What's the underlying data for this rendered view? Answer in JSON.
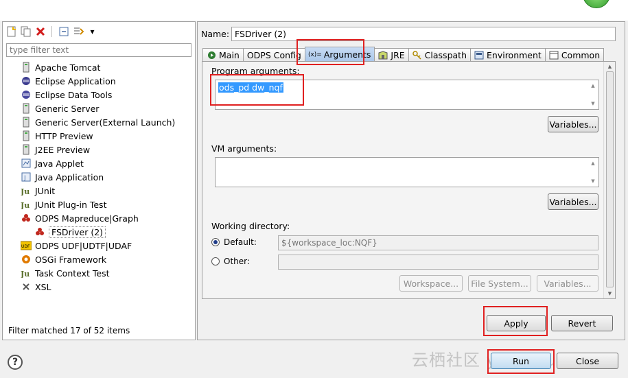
{
  "left_panel": {
    "filter_placeholder": "type filter text",
    "tree": [
      {
        "label": "Apache Tomcat",
        "icon": "tomcat-icon"
      },
      {
        "label": "Eclipse Application",
        "icon": "eclipse-icon"
      },
      {
        "label": "Eclipse Data Tools",
        "icon": "data-tools-icon"
      },
      {
        "label": "Generic Server",
        "icon": "server-icon"
      },
      {
        "label": "Generic Server(External Launch)",
        "icon": "server-icon"
      },
      {
        "label": "HTTP Preview",
        "icon": "server-icon"
      },
      {
        "label": "J2EE Preview",
        "icon": "server-icon"
      },
      {
        "label": "Java Applet",
        "icon": "applet-icon"
      },
      {
        "label": "Java Application",
        "icon": "java-app-icon"
      },
      {
        "label": "JUnit",
        "icon": "junit-icon"
      },
      {
        "label": "JUnit Plug-in Test",
        "icon": "junit-plugin-icon"
      },
      {
        "label": "ODPS Mapreduce|Graph",
        "icon": "odps-icon"
      },
      {
        "label": "FSDriver (2)",
        "icon": "odps-icon",
        "child": true,
        "selected": true
      },
      {
        "label": "ODPS UDF|UDTF|UDAF",
        "icon": "udf-icon"
      },
      {
        "label": "OSGi Framework",
        "icon": "osgi-icon"
      },
      {
        "label": "Task Context Test",
        "icon": "junit-icon"
      },
      {
        "label": "XSL",
        "icon": "xsl-icon"
      }
    ],
    "status": "Filter matched 17 of 52 items"
  },
  "right_panel": {
    "name_label": "Name:",
    "name_value": "FSDriver (2)",
    "tabs": [
      {
        "label": "Main",
        "icon": "main-icon"
      },
      {
        "label": "ODPS Config",
        "icon": ""
      },
      {
        "label": "Arguments",
        "icon": "arguments-icon",
        "active": true
      },
      {
        "label": "JRE",
        "icon": "jre-icon"
      },
      {
        "label": "Classpath",
        "icon": "classpath-icon"
      },
      {
        "label": "Environment",
        "icon": "environment-icon"
      },
      {
        "label": "Common",
        "icon": "common-icon"
      }
    ],
    "program_args_label": "Program arguments:",
    "program_args_value": "ods_pd dw_nqf",
    "vm_args_label": "VM arguments:",
    "vm_args_value": "",
    "variables_label": "Variables...",
    "working_dir_label": "Working directory:",
    "default_label": "Default:",
    "default_value": "${workspace_loc:NQF}",
    "other_label": "Other:",
    "workspace_btn": "Workspace...",
    "filesystem_btn": "File System...",
    "variables_btn": "Variables..."
  },
  "buttons": {
    "apply": "Apply",
    "revert": "Revert",
    "run": "Run",
    "close": "Close"
  },
  "help_icon": "?",
  "watermark": "云栖社区 yq.aliyun.com",
  "colors": {
    "highlight": "#e02020",
    "selection": "#3399ff",
    "active_tab": "#b4cdee"
  }
}
